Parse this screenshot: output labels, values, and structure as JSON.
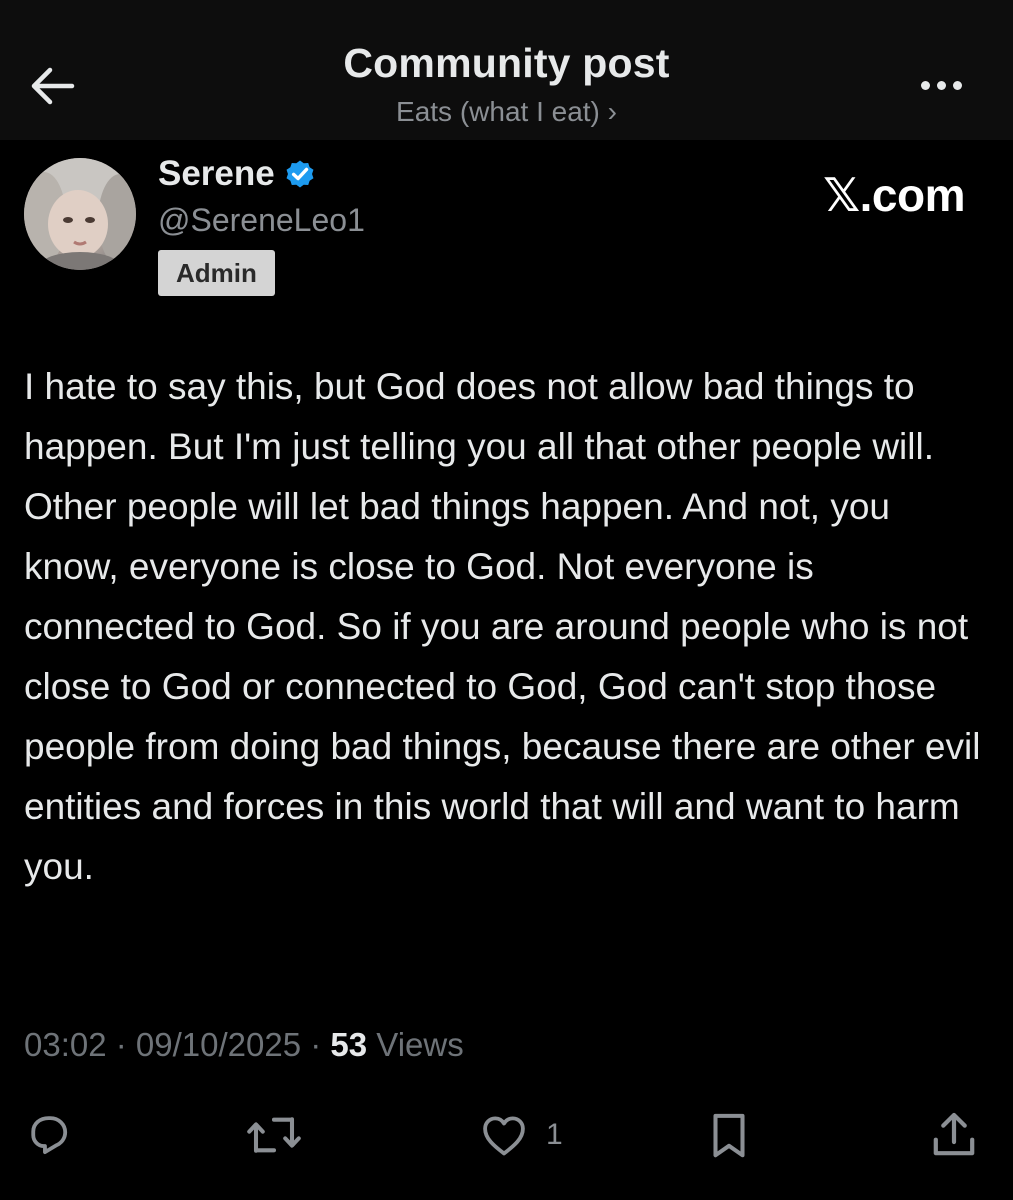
{
  "header": {
    "title": "Community post",
    "subtitle": "Eats (what I eat) ›"
  },
  "author": {
    "display_name": "Serene",
    "handle": "@SereneLeo1",
    "role_badge": "Admin",
    "verified_color": "#1d9bf0"
  },
  "watermark": "𝕏.com",
  "post": {
    "text": "I hate to say this, but God does not allow bad things to happen. But I'm just telling you all that other people will. Other people will let bad things happen. And not, you know, everyone is close to God. Not everyone is connected to God. So if you are around people who is not close to God or connected to God, God can't stop those people from doing bad things, because there are other evil entities and forces in this world that will and want to harm you.",
    "time": "03:02",
    "separator": " · ",
    "date": "09/10/2025",
    "views_count": "53",
    "views_label": " Views"
  },
  "actions": {
    "reply_icon": "reply-icon",
    "repost_icon": "repost-icon",
    "like_icon": "heart-icon",
    "like_count": "1",
    "bookmark_icon": "bookmark-icon",
    "share_icon": "share-icon"
  }
}
